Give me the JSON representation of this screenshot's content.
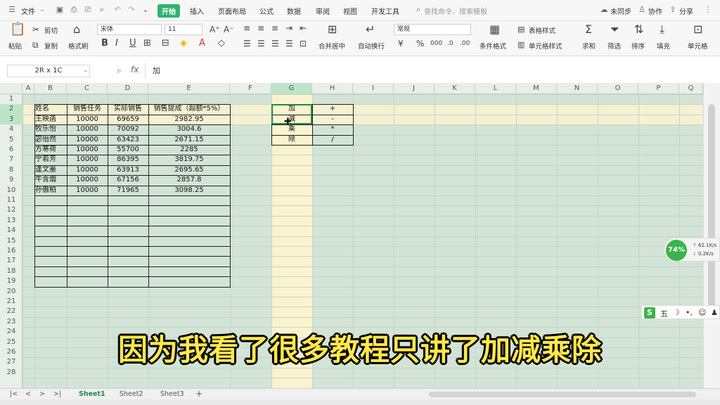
{
  "menu": {
    "file": "文件",
    "tabs": [
      "开始",
      "插入",
      "页面布局",
      "公式",
      "数据",
      "审阅",
      "视图",
      "开发工具"
    ],
    "search_placeholder": "查找命令、搜索模板",
    "sync": "未同步",
    "collab": "协作",
    "share": "分享"
  },
  "ribbon": {
    "paste": "粘贴",
    "cut": "剪切",
    "copy": "复制",
    "format_painter": "格式刷",
    "font_name": "宋体",
    "font_size": "11",
    "bold": "B",
    "italic": "I",
    "underline": "U",
    "merge_center": "合并居中",
    "wrap_text": "自动换行",
    "number_format": "常规",
    "currency": "¥",
    "percent": "%",
    "cond_format": "条件格式",
    "table_style": "表格样式",
    "cell_style": "单元格样式",
    "sum": "求和",
    "filter": "筛选",
    "sort": "排序",
    "fill": "填充",
    "cell": "单元格"
  },
  "formula_bar": {
    "name_box": "2R x 1C",
    "fx": "fx",
    "content": "加"
  },
  "grid": {
    "columns": [
      "A",
      "B",
      "C",
      "D",
      "E",
      "F",
      "G",
      "H",
      "I",
      "J",
      "K",
      "L",
      "M",
      "N",
      "O",
      "P",
      "Q"
    ],
    "rows": [
      "1",
      "2",
      "3",
      "4",
      "5",
      "6",
      "7",
      "8",
      "9",
      "10",
      "11",
      "12",
      "13",
      "14",
      "15",
      "16",
      "17",
      "18",
      "19",
      "20",
      "21",
      "22",
      "23",
      "24",
      "25",
      "26",
      "27",
      "28"
    ],
    "table_header": [
      "姓名",
      "销售任务",
      "实际销售",
      "销售提成（超额*5%）"
    ],
    "table_rows": [
      [
        "王映菡",
        "10000",
        "69659",
        "2982.95"
      ],
      [
        "牧乐怡",
        "10000",
        "70092",
        "3004.6"
      ],
      [
        "宓佁然",
        "10000",
        "63423",
        "2671.15"
      ],
      [
        "方寒荷",
        "10000",
        "55700",
        "2285"
      ],
      [
        "宁若芳",
        "10000",
        "86395",
        "3819.75"
      ],
      [
        "逢文墨",
        "10000",
        "63913",
        "2695.65"
      ],
      [
        "牛含烟",
        "10000",
        "67156",
        "2857.8"
      ],
      [
        "孙傲柏",
        "10000",
        "71965",
        "3098.25"
      ]
    ],
    "ops_names": [
      "加",
      "减",
      "乘",
      "除"
    ],
    "ops_symbols": [
      "+",
      "-",
      "*",
      "/"
    ]
  },
  "sheets": [
    "Sheet1",
    "Sheet2",
    "Sheet3"
  ],
  "active_sheet": "Sheet1",
  "widget": {
    "percent": "74%",
    "up_speed": "62.1K/s",
    "down_speed": "0.2K/s",
    "ime_label": "五"
  },
  "caption": "因为我看了很多教程只讲了加减乘除",
  "colors": {
    "accent": "#2fb36c",
    "grid_bg": "#d3e4d6",
    "column_g_highlight": "#fbf3d0",
    "caption": "#ffe84a"
  }
}
